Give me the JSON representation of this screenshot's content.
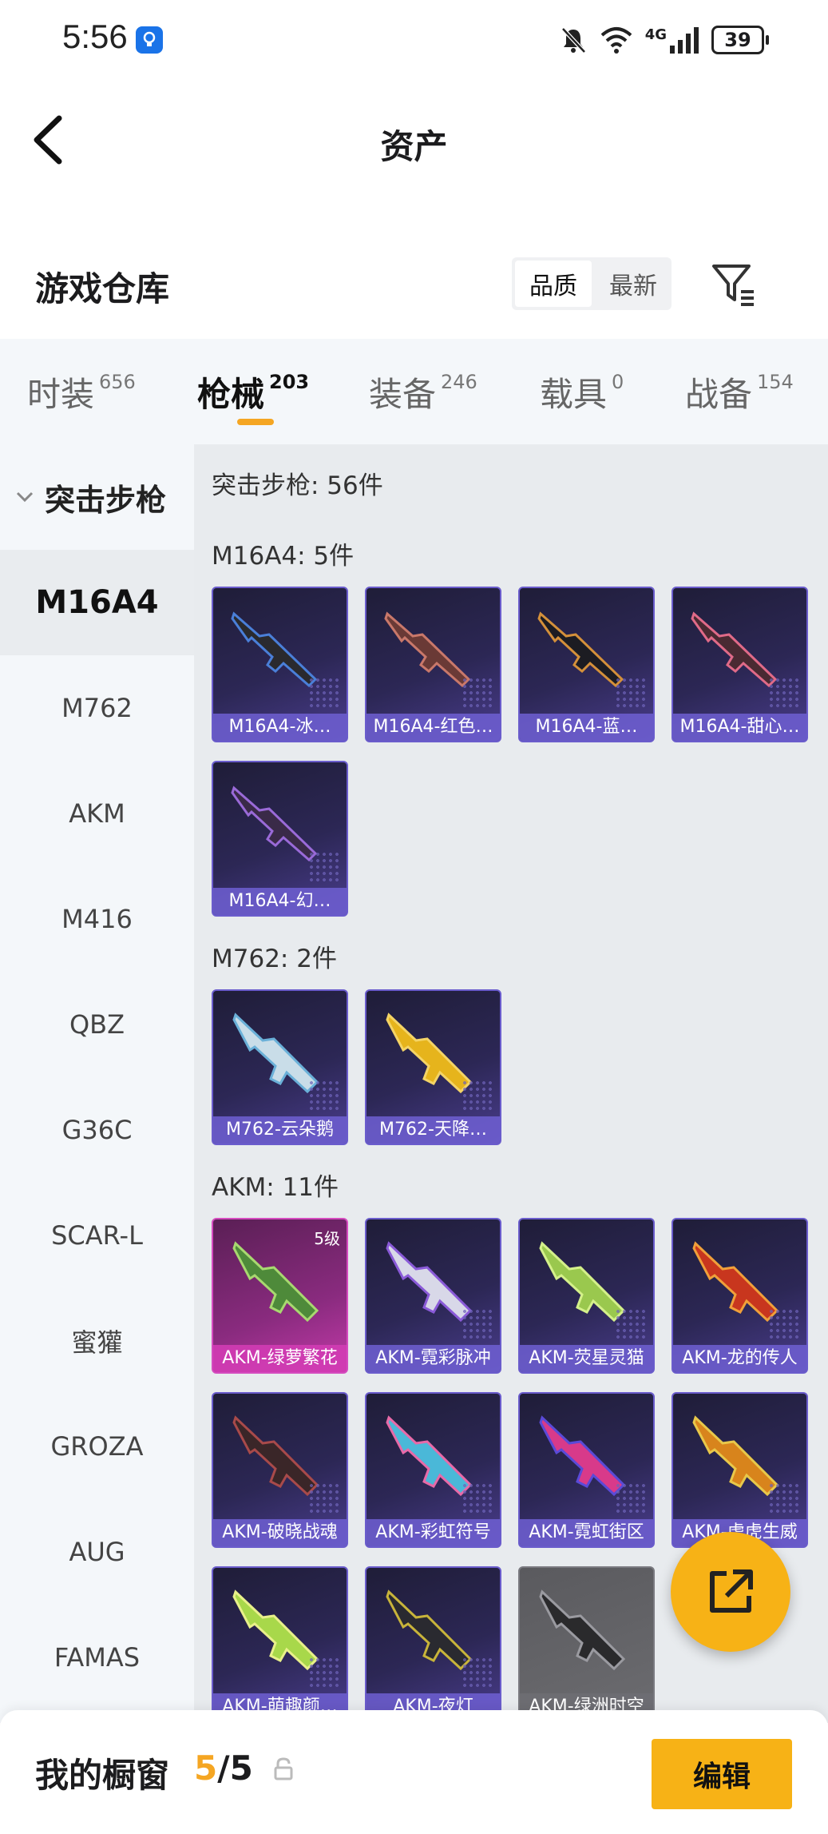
{
  "status_bar": {
    "time": "5:56",
    "network_label": "4G",
    "battery": "39"
  },
  "header": {
    "title": "资产"
  },
  "warehouse": {
    "title": "游戏仓库",
    "sort_options": [
      "品质",
      "最新"
    ]
  },
  "tabs": [
    {
      "label": "时装",
      "count": "656"
    },
    {
      "label": "枪械",
      "count": "203"
    },
    {
      "label": "装备",
      "count": "246"
    },
    {
      "label": "载具",
      "count": "0"
    },
    {
      "label": "战备",
      "count": "154"
    }
  ],
  "sidebar": {
    "group": "突击步枪",
    "items": [
      "M16A4",
      "M762",
      "AKM",
      "M416",
      "QBZ",
      "G36C",
      "SCAR-L",
      "蜜獾",
      "GROZA",
      "AUG",
      "FAMAS"
    ]
  },
  "content": {
    "summary": "突击步枪: 56件",
    "sections": [
      {
        "label": "M16A4: 5件",
        "items": [
          "M16A4-冰…",
          "M16A4-红色…",
          "M16A4-蓝…",
          "M16A4-甜心…",
          "M16A4-幻…"
        ]
      },
      {
        "label": "M762: 2件",
        "items": [
          "M762-云朵鹅",
          "M762-天降…"
        ]
      },
      {
        "label": "AKM: 11件",
        "items": [
          "AKM-绿萝繁花",
          "AKM-霓彩脉冲",
          "AKM-荧星灵猫",
          "AKM-龙的传人",
          "AKM-破晓战魂",
          "AKM-彩虹符号",
          "AKM-霓虹街区",
          "AKM-虎虎生威",
          "AKM-萌趣颜…",
          "AKM-夜灯",
          "AKM-绿洲时空"
        ],
        "first_item_level": "5级"
      }
    ]
  },
  "bottom_bar": {
    "label": "我的橱窗",
    "current": "5",
    "separator": "/",
    "total": "5",
    "edit_label": "编辑"
  },
  "colors": {
    "accent": "#f7b216",
    "card_border": "#6a5ccc",
    "card_pink": "#d54bbf"
  }
}
